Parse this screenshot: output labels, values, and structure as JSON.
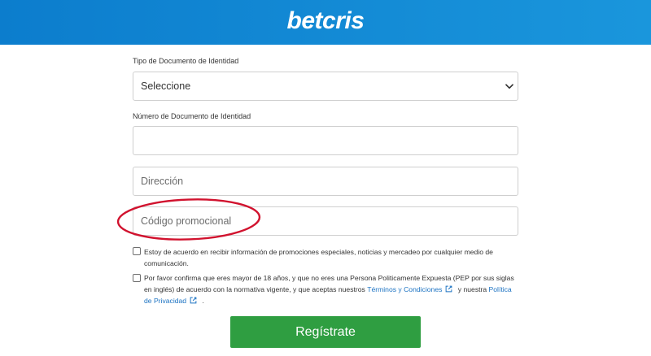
{
  "header": {
    "logo_text": "betcris"
  },
  "form": {
    "document_type": {
      "label": "Tipo de Documento de Identidad",
      "selected": "Seleccione"
    },
    "document_number": {
      "label": "Número de Documento de Identidad",
      "value": ""
    },
    "address": {
      "placeholder": "Dirección",
      "value": ""
    },
    "promo_code": {
      "placeholder": "Código promocional",
      "value": ""
    },
    "marketing_consent": {
      "checked": false,
      "text": "Estoy de acuerdo en recibir información de promociones especiales, noticias y mercadeo por cualquier medio de comunicación."
    },
    "terms_consent": {
      "checked": false,
      "text_before": "Por favor confirma que eres mayor de 18 años, y que no eres una Persona Politicamente Expuesta (PEP por sus siglas en inglés) de acuerdo con la normativa vigente, y que aceptas nuestros ",
      "terms_link": "Términos y Condiciones",
      "text_middle": " y nuestra ",
      "privacy_link": "Política de Privacidad",
      "text_after": " ."
    },
    "submit_label": "Regístrate"
  },
  "icons": {
    "select_arrow": "chevron-down-icon",
    "external_link": "external-link-icon"
  },
  "colors": {
    "header_blue_dark": "#0c7dcd",
    "header_blue": "#1a96dc",
    "button_green": "#2f9e41",
    "link_blue": "#1b72c2",
    "annotation_red": "#d1122e",
    "text_dark": "#333333",
    "border_gray": "#cfcfcf",
    "placeholder_gray": "#6b6b6b"
  }
}
